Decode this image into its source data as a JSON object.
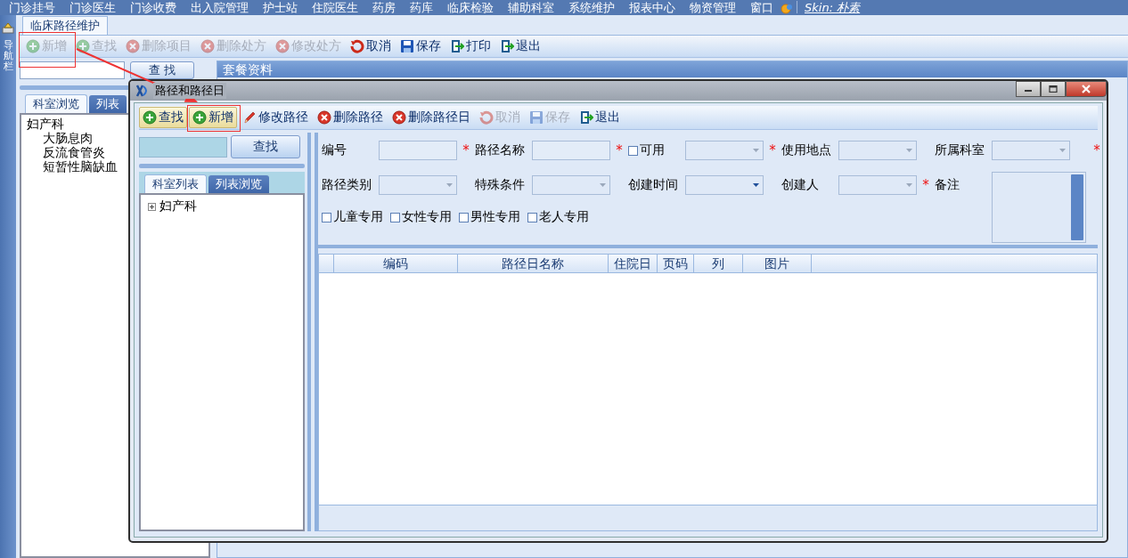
{
  "menu": [
    {
      "label": "门诊挂号"
    },
    {
      "label": "门诊医生"
    },
    {
      "label": "门诊收费"
    },
    {
      "label": "出入院管理"
    },
    {
      "label": "护士站"
    },
    {
      "label": "住院医生"
    },
    {
      "label": "药房"
    },
    {
      "label": "药库"
    },
    {
      "label": "临床检验"
    },
    {
      "label": "辅助科室"
    },
    {
      "label": "系统维护"
    },
    {
      "label": "报表中心"
    },
    {
      "label": "物资管理"
    },
    {
      "label": "窗口"
    }
  ],
  "skin_link": "Skin: 朴素",
  "nav_strip": {
    "label": "导航栏"
  },
  "app_tabs": [
    {
      "label": "临床路径维护",
      "selected": true
    }
  ],
  "toolbar": [
    {
      "label": "新增",
      "kind": "add",
      "disabled": true,
      "highlighted": true
    },
    {
      "label": "查找",
      "kind": "add",
      "disabled": true,
      "highlighted": false
    },
    {
      "label": "删除项目",
      "kind": "delete",
      "disabled": true,
      "highlighted": false
    },
    {
      "label": "删除处方",
      "kind": "delete",
      "disabled": true,
      "highlighted": false
    },
    {
      "label": "修改处方",
      "kind": "delete",
      "disabled": true,
      "highlighted": false
    },
    {
      "label": "取消",
      "kind": "undo",
      "disabled": false,
      "highlighted": false
    },
    {
      "label": "保存",
      "kind": "save",
      "disabled": false,
      "highlighted": false
    },
    {
      "label": "打印",
      "kind": "exit",
      "disabled": false,
      "highlighted": false
    },
    {
      "label": "退出",
      "kind": "exit",
      "disabled": false,
      "highlighted": false
    }
  ],
  "left_panel": {
    "search_button": "查 找",
    "tabs": [
      {
        "label": "科室浏览",
        "selected": true
      },
      {
        "label": "列表",
        "selected": false
      }
    ],
    "tree": [
      {
        "label": "妇产科",
        "children": [
          {
            "label": "大肠息肉"
          },
          {
            "label": "反流食管炎"
          },
          {
            "label": "短暂性脑缺血"
          }
        ]
      }
    ]
  },
  "right_panel": {
    "title": "套餐资料"
  },
  "dialog": {
    "title": "路径和路径日",
    "toolbar": [
      {
        "label": "查找",
        "kind": "add",
        "disabled": false,
        "highlighted": false,
        "raised": true
      },
      {
        "label": "新增",
        "kind": "add",
        "disabled": false,
        "highlighted": true,
        "raised": true
      },
      {
        "label": "修改路径",
        "kind": "edit",
        "disabled": false,
        "highlighted": false,
        "raised": false
      },
      {
        "label": "删除路径",
        "kind": "delete",
        "disabled": false,
        "highlighted": false,
        "raised": false
      },
      {
        "label": "删除路径日",
        "kind": "delete",
        "disabled": false,
        "highlighted": false,
        "raised": false
      },
      {
        "label": "取消",
        "kind": "undo",
        "disabled": true,
        "highlighted": false,
        "raised": false
      },
      {
        "label": "保存",
        "kind": "save",
        "disabled": true,
        "highlighted": false,
        "raised": false
      },
      {
        "label": "退出",
        "kind": "exit",
        "disabled": false,
        "highlighted": false,
        "raised": false
      }
    ],
    "search_button": "查找",
    "tabs": [
      {
        "label": "科室列表",
        "selected": true
      },
      {
        "label": "列表浏览",
        "selected": false
      }
    ],
    "tree": [
      {
        "label": "妇产科",
        "expanded": false
      }
    ],
    "form_rows": [
      [
        {
          "label": "编号",
          "kind": "text",
          "suffix": "*"
        },
        {
          "label": "路径名称",
          "kind": "text",
          "suffix": "*"
        },
        {
          "label": "可用",
          "kind": "check_combo",
          "checked": false,
          "suffix": "*"
        },
        {
          "label": "使用地点",
          "kind": "combo"
        },
        {
          "label": "所属科室",
          "kind": "combo",
          "suffix": "*"
        }
      ],
      [
        {
          "label": "路径类别",
          "kind": "combo"
        },
        {
          "label": "特殊条件",
          "kind": "combo"
        },
        {
          "label": "创建时间",
          "kind": "date"
        },
        {
          "label": "创建人",
          "kind": "combo",
          "suffix": "*"
        },
        {
          "label": "备注",
          "kind": "memo"
        }
      ]
    ],
    "checkboxes": [
      {
        "label": "儿童专用",
        "checked": false
      },
      {
        "label": "女性专用",
        "checked": false
      },
      {
        "label": "男性专用",
        "checked": false
      },
      {
        "label": "老人专用",
        "checked": false
      }
    ],
    "grid_columns": [
      {
        "label": "编码"
      },
      {
        "label": "路径日名称"
      },
      {
        "label": "住院日"
      },
      {
        "label": "页码"
      },
      {
        "label": "列"
      },
      {
        "label": "图片"
      }
    ]
  }
}
